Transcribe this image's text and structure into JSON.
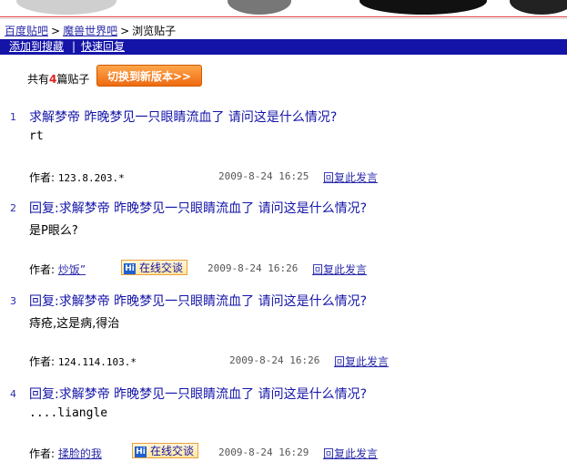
{
  "breadcrumb": {
    "items": [
      "百度贴吧",
      "魔兽世界吧",
      "浏览贴子"
    ],
    "separator": ">"
  },
  "navbar": {
    "add_favorite": "添加到搜藏",
    "separator": "|",
    "quick_reply": "快速回复",
    "bg_color": "#1414a8"
  },
  "summary": {
    "prefix": "共有",
    "count": "4",
    "suffix": "篇贴子",
    "switch_button": "切换到新版本>>"
  },
  "posts": [
    {
      "index": "1",
      "title": "求解梦帝 昨晚梦见一只眼睛流血了 请问这是什么情况?",
      "body": "rt",
      "author_label": "作者:",
      "author": "123.8.203.*",
      "date": "2009-8-24 16:25",
      "reply": "回复此发言"
    },
    {
      "index": "2",
      "title": "回复:求解梦帝 昨晚梦见一只眼睛流血了 请问这是什么情况?",
      "body": "是P眼么?",
      "author_label": "作者:",
      "author": "炒饭”",
      "chat": "在线交谈",
      "chat_icon": "hi-icon",
      "date": "2009-8-24 16:26",
      "reply": "回复此发言"
    },
    {
      "index": "3",
      "title": "回复:求解梦帝 昨晚梦见一只眼睛流血了 请问这是什么情况?",
      "body": "痔疮,这是病,得治",
      "author_label": "作者:",
      "author": "124.114.103.*",
      "date": "2009-8-24 16:26",
      "reply": "回复此发言"
    },
    {
      "index": "4",
      "title": "回复:求解梦帝 昨晚梦见一只眼睛流血了 请问这是什么情况?",
      "body": "....liangle",
      "author_label": "作者:",
      "author": "揉脸的我",
      "chat": "在线交谈",
      "chat_icon": "hi-icon",
      "date": "2009-8-24 16:29",
      "reply": "回复此发言"
    }
  ]
}
